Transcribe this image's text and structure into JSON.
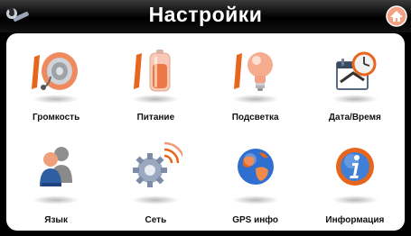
{
  "header": {
    "title": "Настройки",
    "left_icon": "wrench-icon",
    "right_icon": "home-icon"
  },
  "menu": {
    "items": [
      {
        "label": "Громкость",
        "icon": "speaker-icon"
      },
      {
        "label": "Питание",
        "icon": "battery-icon"
      },
      {
        "label": "Подсветка",
        "icon": "lightbulb-icon"
      },
      {
        "label": "Дата/Время",
        "icon": "calendar-clock-icon"
      },
      {
        "label": "Язык",
        "icon": "people-icon"
      },
      {
        "label": "Сеть",
        "icon": "network-gear-icon"
      },
      {
        "label": "GPS инфо",
        "icon": "globe-icon"
      },
      {
        "label": "Информация",
        "icon": "info-icon"
      }
    ]
  },
  "colors": {
    "accent_orange": "#e8661c",
    "panel": "#ffffff",
    "background": "#000000"
  }
}
